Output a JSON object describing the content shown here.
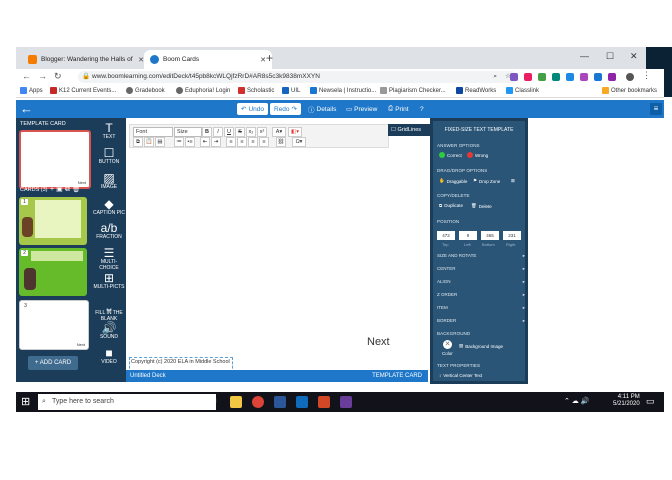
{
  "browser": {
    "tabs": [
      {
        "title": "Blogger: Wandering the Halls of",
        "active": false
      },
      {
        "title": "Boom Cards",
        "active": true
      }
    ],
    "url": "www.boomlearning.com/editDeck/t45pb8kcWLQjfzRrD#AR8s5c3k9838mXXYN",
    "bookmarks": [
      "Apps",
      "K12 Current Events...",
      "Gradebook",
      "Eduphoria! Login",
      "Scholastic",
      "UIL",
      "Newsela | Instructio...",
      "Plagiarism Checker...",
      "ReadWorks",
      "Classlink",
      "Other bookmarks"
    ]
  },
  "toolbar": {
    "undo": "Undo",
    "redo": "Redo",
    "details": "Details",
    "preview": "Preview",
    "print": "Print",
    "help": "?"
  },
  "left_panel": {
    "template_header": "TEMPLATE CARD",
    "cards_header": "CARDS (3)",
    "card_numbers": [
      "1",
      "2",
      "3"
    ],
    "next_label": "Next",
    "add_card": "+ ADD CARD"
  },
  "tools": [
    "TEXT",
    "BUTTON",
    "IMAGE",
    "CAPTION PIC",
    "FRACTION",
    "MULTI-CHOICE",
    "MULTI-PICTS",
    "FILL IN THE BLANK",
    "SOUND",
    "VIDEO"
  ],
  "editor": {
    "font_select": "Font",
    "size_select": "Size",
    "gridlines": "GridLines",
    "next_text": "Next",
    "copyright": "Copyright (c) 2020 ELA in Middle School",
    "deck_title": "Untitled Deck",
    "template_label": "TEMPLATE CARD"
  },
  "props": {
    "title": "FIXED-SIZE TEXT TEMPLATE",
    "answer_options": "ANSWER OPTIONS",
    "correct": "Correct",
    "wrong": "Wrong",
    "dragdrop": "DRAG/DROP OPTIONS",
    "draggable": "Draggable",
    "dropzone": "Drop Zone",
    "copydelete": "COPY/DELETE",
    "duplicate": "Duplicate",
    "delete": "Delete",
    "position": "POSITION",
    "pos_values": [
      "472",
      "9",
      "465",
      "231"
    ],
    "pos_labels": [
      "Top",
      "Left",
      "Bottom",
      "Right"
    ],
    "sections": [
      "SIZE AND ROTATE",
      "CENTER",
      "ALIGN",
      "Z ORDER",
      "ITEM",
      "BORDER"
    ],
    "background": "BACKGROUND",
    "color": "Color",
    "bg_image": "Background Image",
    "text_props": "TEXT PROPERTIES",
    "vcenter": "Vertical Center Text"
  },
  "taskbar": {
    "search": "Type here to search",
    "time": "4:11 PM",
    "date": "5/21/2020"
  },
  "colors": {
    "accent": "#1e77c8",
    "panel": "#1c3d5a",
    "props": "#2a5577",
    "correct": "#2ecc40",
    "wrong": "#e53935"
  }
}
